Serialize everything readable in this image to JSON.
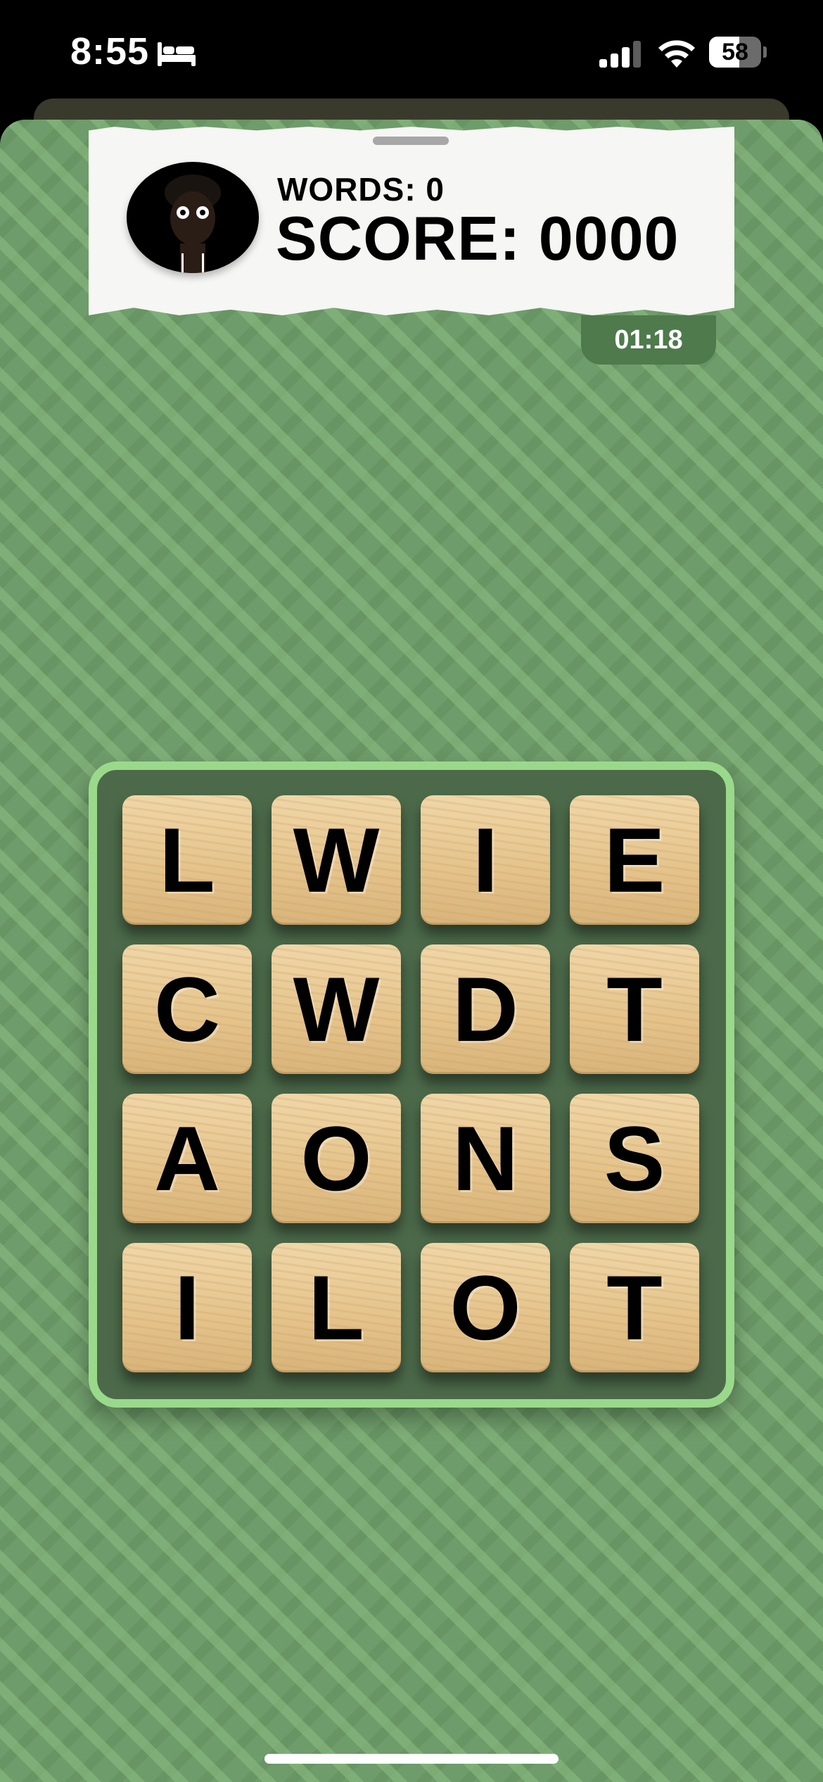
{
  "status_bar": {
    "time": "8:55",
    "focus_icon": "bed-icon",
    "signal_icon": "cellular-signal-icon",
    "wifi_icon": "wifi-icon",
    "battery_level": "58",
    "battery_fraction": 0.58
  },
  "scoreboard": {
    "words_label": "WORDS: 0",
    "score_label": "SCORE: 0000",
    "avatar_icon": "player-avatar-icon"
  },
  "timer": {
    "value": "01:18"
  },
  "board": {
    "rows": [
      [
        "L",
        "W",
        "I",
        "E"
      ],
      [
        "C",
        "W",
        "D",
        "T"
      ],
      [
        "A",
        "O",
        "N",
        "S"
      ],
      [
        "I",
        "L",
        "O",
        "T"
      ]
    ]
  },
  "colors": {
    "background": "#6f9c6b",
    "board_border": "#9ad98c",
    "board_fill": "#4c6a4a",
    "timer_bg": "#4e7a4c",
    "tile": "#e4c28a"
  }
}
